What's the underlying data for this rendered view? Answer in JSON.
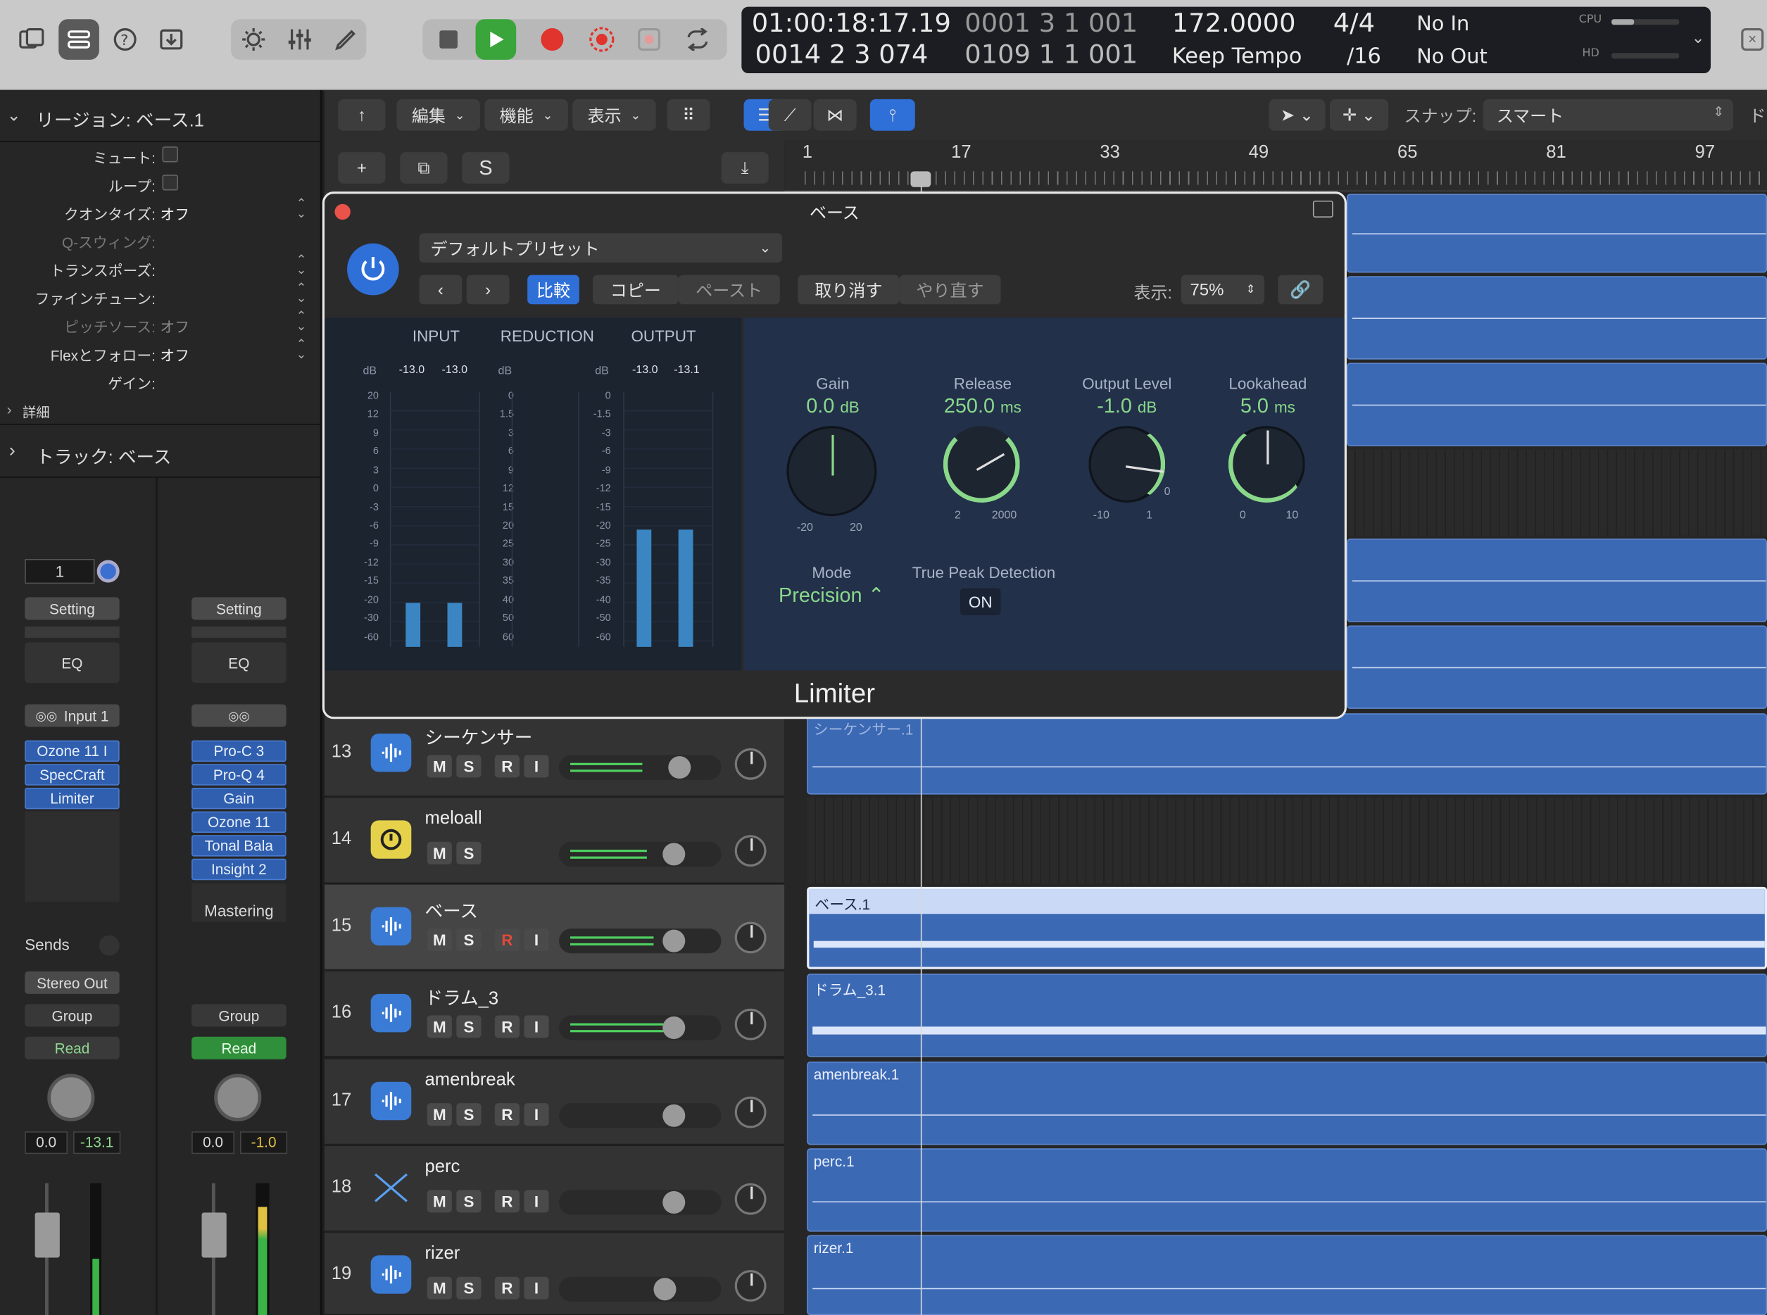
{
  "toolbar": {
    "lcd": {
      "time": "01:00:18:17.19",
      "bars_a": "0001  3  1  001",
      "bars_b": "0014  2  3  074",
      "bars_c": "0109  1  1  001",
      "tempo": "172.0000",
      "tempo_mode": "Keep Tempo",
      "sig": "4/4",
      "div": "/16",
      "in": "No In",
      "out": "No Out",
      "cpu": "CPU",
      "hd": "HD"
    }
  },
  "control_bar": {
    "edit": "編集",
    "functions": "機能",
    "view": "表示",
    "snap_label": "スナップ:",
    "snap_value": "スマート",
    "drag_label": "ド"
  },
  "track_header_btns": {
    "add": "+",
    "dup": "⧉",
    "solo": "S"
  },
  "ruler": {
    "marks": [
      "1",
      "17",
      "33",
      "49",
      "65",
      "81",
      "97"
    ]
  },
  "inspector": {
    "region_title": "リージョン: ベース.1",
    "mute": "ミュート:",
    "loop": "ループ:",
    "quantize": "クオンタイズ:",
    "quantize_val": "オフ",
    "qswing": "Q-スウィング:",
    "transpose": "トランスポーズ:",
    "finetune": "ファインチューン:",
    "pitch": "ピッチソース:",
    "pitch_val": "オフ",
    "flex": "Flexとフォロー:",
    "flex_val": "オフ",
    "gain": "ゲイン:",
    "details": "詳細",
    "track_title": "トラック: ベース"
  },
  "strip_left": {
    "num": "1",
    "setting": "Setting",
    "eq": "EQ",
    "input": "Input 1",
    "plugins": [
      "Ozone 11 I",
      "SpecCraft",
      "Limiter"
    ],
    "sends": "Sends",
    "output": "Stereo Out",
    "group": "Group",
    "read": "Read",
    "vol": "0.0",
    "peak": "-13.1"
  },
  "strip_right": {
    "setting": "Setting",
    "eq": "EQ",
    "plugins": [
      "Pro-C 3",
      "Pro-Q 4",
      "Gain",
      "Ozone 11",
      "Tonal Bala",
      "Insight 2"
    ],
    "mastering": "Mastering",
    "group": "Group",
    "read": "Read",
    "vol": "0.0",
    "peak": "-1.0"
  },
  "tracks": [
    {
      "num": "13",
      "name": "シーケンサー",
      "region": "シーケンサー.1"
    },
    {
      "num": "14",
      "name": "meloall",
      "region": ""
    },
    {
      "num": "15",
      "name": "ベース",
      "region": "ベース.1"
    },
    {
      "num": "16",
      "name": "ドラム_3",
      "region": "ドラム_3.1"
    },
    {
      "num": "17",
      "name": "amenbreak",
      "region": "amenbreak.1"
    },
    {
      "num": "18",
      "name": "perc",
      "region": "perc.1"
    },
    {
      "num": "19",
      "name": "rizer",
      "region": "rizer.1"
    }
  ],
  "track_btn": {
    "m": "M",
    "s": "S",
    "r": "R",
    "i": "I"
  },
  "plugin": {
    "title": "ベース",
    "preset": "デフォルトプリセット",
    "compare": "比較",
    "copy": "コピー",
    "paste": "ペースト",
    "undo": "取り消す",
    "redo": "やり直す",
    "view_label": "表示:",
    "view_val": "75%",
    "name": "Limiter",
    "meters": {
      "input": "INPUT",
      "reduction": "REDUCTION",
      "output": "OUTPUT",
      "db": "dB",
      "in_l": "-13.0",
      "in_r": "-13.0",
      "out_l": "-13.0",
      "out_r": "-13.1",
      "in_scale": [
        "20",
        "12",
        "9",
        "6",
        "3",
        "0",
        "-3",
        "-6",
        "-9",
        "-12",
        "-15",
        "-20",
        "-30",
        "-60"
      ],
      "red_scale": [
        "0",
        "1.5",
        "3",
        "6",
        "9",
        "12",
        "15",
        "20",
        "25",
        "30",
        "35",
        "40",
        "50",
        "60"
      ],
      "out_scale": [
        "0",
        "-1.5",
        "-3",
        "-6",
        "-9",
        "-12",
        "-15",
        "-20",
        "-25",
        "-30",
        "-35",
        "-40",
        "-50",
        "-60"
      ]
    },
    "gain": {
      "label": "Gain",
      "value": "0.0",
      "unit": "dB",
      "min": "-20",
      "max": "20"
    },
    "release": {
      "label": "Release",
      "value": "250.0",
      "unit": "ms",
      "min": "2",
      "max": "2000"
    },
    "output": {
      "label": "Output Level",
      "value": "-1.0",
      "unit": "dB",
      "min": "-10",
      "max": "1",
      "zero": "0"
    },
    "lookahead": {
      "label": "Lookahead",
      "value": "5.0",
      "unit": "ms",
      "min": "0",
      "max": "10"
    },
    "mode": {
      "label": "Mode",
      "value": "Precision ⌃"
    },
    "tpd": {
      "label": "True Peak Detection",
      "value": "ON"
    }
  }
}
